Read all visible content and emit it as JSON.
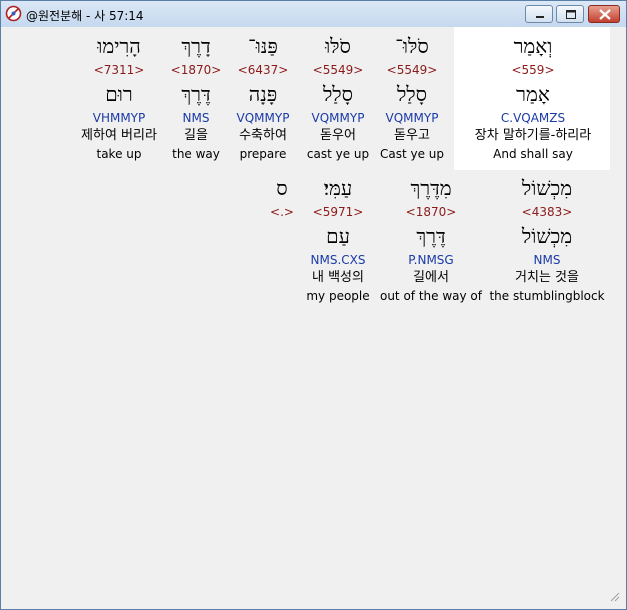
{
  "window": {
    "title": "@원전분해 - 사 57:14"
  },
  "row1": [
    {
      "word": "וְאָמַר",
      "strong": "<559>",
      "lemma": "אָמַר",
      "morph": "C.VQAMZS",
      "korean": "장차 말하기를-하리라",
      "english": "And shall say"
    },
    {
      "word": "סֹלּוּ־",
      "strong": "<5549>",
      "lemma": "סָלַל",
      "morph": "VQMMYP",
      "korean": "돋우고",
      "english": "Cast ye up"
    },
    {
      "word": "סֹלּוּ",
      "strong": "<5549>",
      "lemma": "סָלַל",
      "morph": "VQMMYP",
      "korean": "돋우어",
      "english": "cast ye up"
    },
    {
      "word": "פַּנּוּ־",
      "strong": "<6437>",
      "lemma": "פָּנָה",
      "morph": "VQMMYP",
      "korean": "수축하여",
      "english": "prepare"
    },
    {
      "word": "דָרֶךְ",
      "strong": "<1870>",
      "lemma": "דֶּרֶךְ",
      "morph": "NMS",
      "korean": "길을",
      "english": "the way"
    },
    {
      "word": "הָרִימוּ",
      "strong": "<7311>",
      "lemma": "רוּם",
      "morph": "VHMMYP",
      "korean": "제하여 버리라",
      "english": "take up"
    }
  ],
  "row2": [
    {
      "word": "מִכְשׁוֹל",
      "strong": "<4383>",
      "lemma": "מִכְשׁוֹל",
      "morph": "NMS",
      "korean": "거치는 것을",
      "english": "the stumblingblock"
    },
    {
      "word": "מִדֶּרֶךְ",
      "strong": "<1870>",
      "lemma": "דֶּרֶךְ",
      "morph": "P.NMSG",
      "korean": "길에서",
      "english": "out of the way of"
    },
    {
      "word": "עַמִּי׃",
      "strong": "<5971>",
      "lemma": "עַם",
      "morph": "NMS.CXS",
      "korean": "내 백성의",
      "english": "my people"
    },
    {
      "word": "ס",
      "strong": "<.>",
      "lemma": "",
      "morph": "",
      "korean": "",
      "english": ""
    }
  ]
}
